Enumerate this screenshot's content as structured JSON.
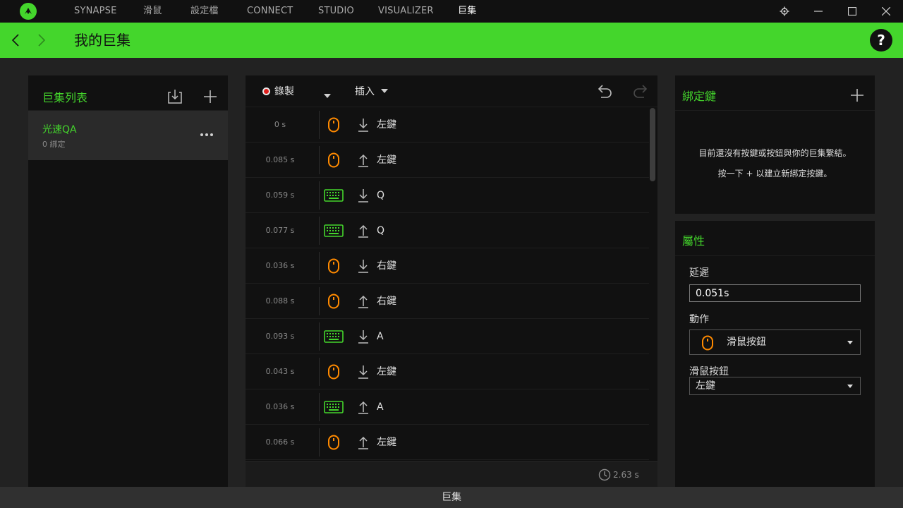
{
  "nav": {
    "tabs": [
      "SYNAPSE",
      "滑鼠",
      "設定檔",
      "CONNECT",
      "STUDIO",
      "VISUALIZER",
      "巨集"
    ],
    "active_tab": "巨集"
  },
  "header": {
    "title": "我的巨集",
    "help_label": "?"
  },
  "macro_list": {
    "title": "巨集列表",
    "items": [
      {
        "name": "光速QA",
        "bindings": "0 綁定"
      }
    ]
  },
  "toolbar": {
    "record_label": "錄製",
    "insert_label": "插入"
  },
  "events": [
    {
      "time": "0 s",
      "device": "mouse",
      "direction": "down",
      "key": "左鍵"
    },
    {
      "time": "0.085 s",
      "device": "mouse",
      "direction": "up",
      "key": "左鍵"
    },
    {
      "time": "0.059 s",
      "device": "keyboard",
      "direction": "down",
      "key": "Q"
    },
    {
      "time": "0.077 s",
      "device": "keyboard",
      "direction": "up",
      "key": "Q"
    },
    {
      "time": "0.036 s",
      "device": "mouse",
      "direction": "down",
      "key": "右鍵"
    },
    {
      "time": "0.088 s",
      "device": "mouse",
      "direction": "up",
      "key": "右鍵"
    },
    {
      "time": "0.093 s",
      "device": "keyboard",
      "direction": "down",
      "key": "A"
    },
    {
      "time": "0.043 s",
      "device": "mouse",
      "direction": "down",
      "key": "左鍵"
    },
    {
      "time": "0.036 s",
      "device": "keyboard",
      "direction": "up",
      "key": "A"
    },
    {
      "time": "0.066 s",
      "device": "mouse",
      "direction": "up",
      "key": "左鍵"
    }
  ],
  "total_time": "2.63 s",
  "bindings": {
    "title": "綁定鍵",
    "empty_line1": "目前還沒有按鍵或按鈕與你的巨集繫結。",
    "empty_line2": "按一下 + 以建立新綁定按鍵。"
  },
  "properties": {
    "title": "屬性",
    "delay_label": "延遲",
    "delay_value": "0.051s",
    "action_label": "動作",
    "action_value": "滑鼠按鈕",
    "mouse_button_label": "滑鼠按鈕",
    "mouse_button_value": "左鍵"
  },
  "status_bar": {
    "label": "巨集"
  },
  "colors": {
    "accent": "#44d62c",
    "mouse_icon": "#ff8a00",
    "keyboard_icon": "#44d62c",
    "record": "#e0201e"
  }
}
